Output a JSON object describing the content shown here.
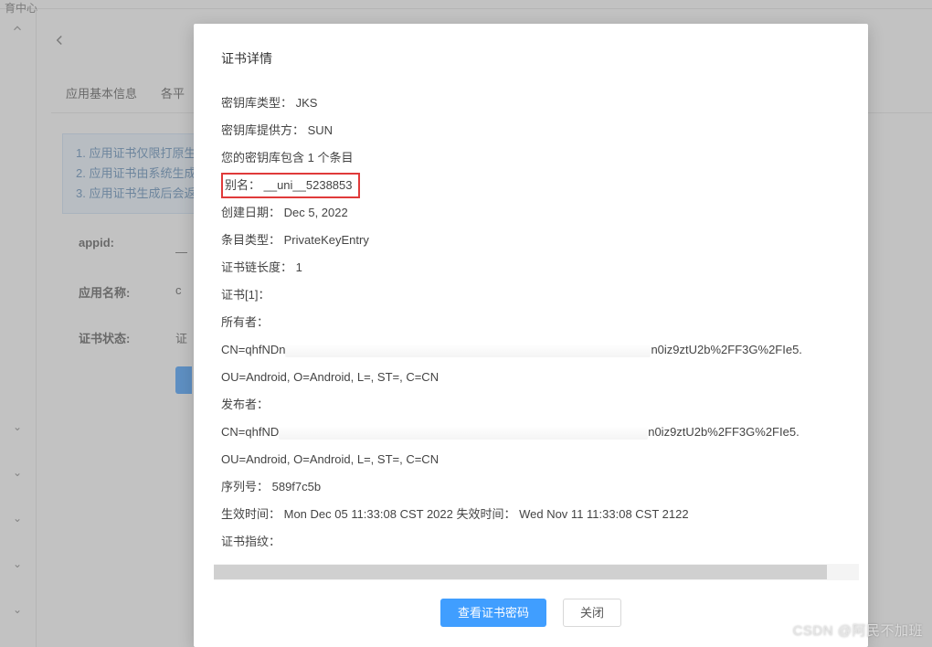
{
  "bg": {
    "header_crumb": "育中心",
    "tabs": {
      "t1": "应用基本信息",
      "t2": "各平"
    },
    "notice": {
      "l1": "1. 应用证书仅限打原生",
      "l2": "2. 应用证书由系统生成",
      "l3": "3. 应用证书生成后会返"
    },
    "labels": {
      "appid": "appid:",
      "appname": "应用名称:",
      "certstatus": "证书状态:"
    },
    "values": {
      "appid": "—",
      "appname": "c",
      "certstatus": "证"
    }
  },
  "modal": {
    "title": "证书详情",
    "lines": {
      "keystore_type": "密钥库类型： JKS",
      "keystore_provider": "密钥库提供方： SUN",
      "keystore_contains": "您的密钥库包含  1 个条目",
      "alias": "别名： __uni__5238853",
      "created": "创建日期： Dec 5, 2022",
      "entry_type": "条目类型： PrivateKeyEntry",
      "chain_len": "证书链长度： 1",
      "cert_idx": "证书[1]：",
      "owner_label": "所有者：",
      "owner_cn_prefix": "CN=qhfNDn",
      "owner_cn_suffix": "n0iz9ztU2b%2FF3G%2FIe5.",
      "owner_ou": "OU=Android, O=Android, L=, ST=, C=CN",
      "issuer_label": "发布者：",
      "issuer_cn_prefix": "CN=qhfND",
      "issuer_cn_suffix": "n0iz9ztU2b%2FF3G%2FIe5.",
      "issuer_ou": "OU=Android, O=Android, L=, ST=, C=CN",
      "serial": "序列号： 589f7c5b",
      "validity": "生效时间： Mon Dec 05 11:33:08 CST 2022 失效时间： Wed Nov 11 11:33:08 CST 2122",
      "fingerprint_label": "证书指纹："
    },
    "buttons": {
      "view_pwd": "查看证书密码",
      "close": "关闭"
    }
  },
  "watermark": "CSDN @阿民不加班"
}
